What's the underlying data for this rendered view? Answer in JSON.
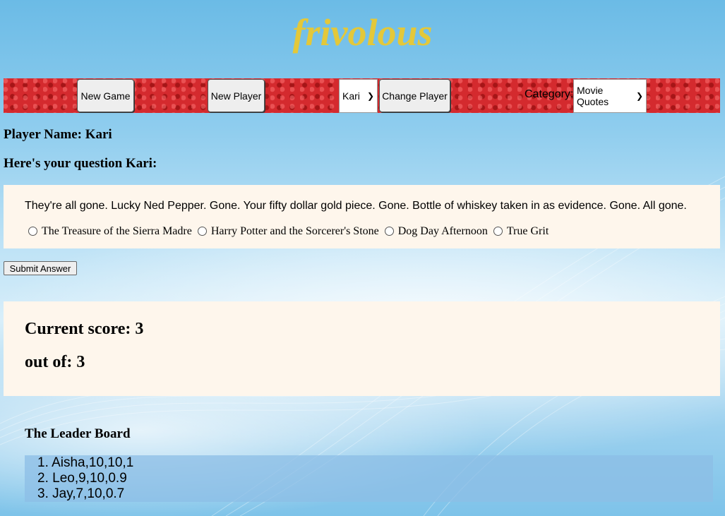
{
  "app": {
    "title": "frivolous"
  },
  "toolbar": {
    "new_game": "New Game",
    "new_player": "New Player",
    "player_select": "Kari",
    "change_player": "Change Player",
    "category_label": "Category:",
    "category_select": "Movie Quotes"
  },
  "player": {
    "name_line": "Player Name: Kari",
    "question_heading": "Here's your question Kari:"
  },
  "question": {
    "text": "They're all gone. Lucky Ned Pepper. Gone. Your fifty dollar gold piece. Gone. Bottle of whiskey taken in as evidence. Gone. All gone.",
    "options": [
      "The Treasure of the Sierra Madre",
      "Harry Potter and the Sorcerer's Stone",
      "Dog Day Afternoon",
      "True Grit"
    ],
    "submit_label": "Submit Answer"
  },
  "score": {
    "current": "Current score: 3",
    "out_of": "out of: 3"
  },
  "leaderboard": {
    "title": "The Leader Board",
    "entries": [
      "Aisha,10,10,1",
      "Leo,9,10,0.9",
      "Jay,7,10,0.7"
    ]
  }
}
